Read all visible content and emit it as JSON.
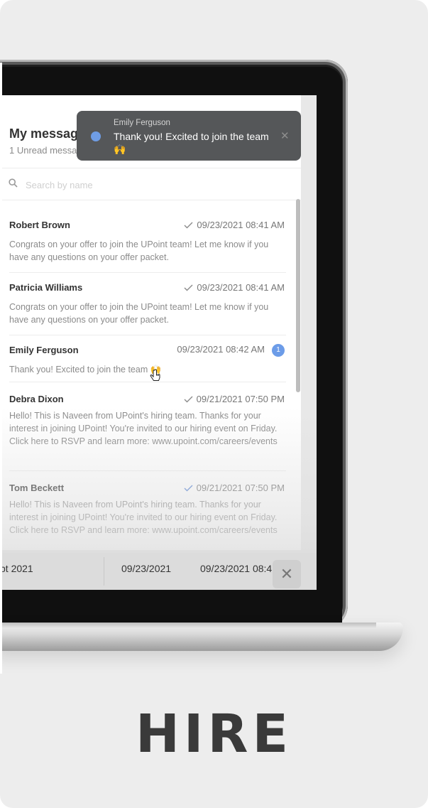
{
  "panel": {
    "title": "My messages",
    "subtitle": "1 Unread messages"
  },
  "search": {
    "placeholder": "Search by name",
    "icon": "search-icon"
  },
  "threads": [
    {
      "name": "Robert Brown",
      "time": "09/23/2021 08:41 AM",
      "status": "read-check",
      "preview": "Congrats on your offer to join the UPoint team! Let me know if you have any questions on your offer packet."
    },
    {
      "name": "Patricia Williams",
      "time": "09/23/2021 08:41 AM",
      "status": "read-check",
      "preview": "Congrats on your offer to join the UPoint team! Let me know if you have any questions on your offer packet."
    },
    {
      "name": "Emily Ferguson",
      "time": "09/23/2021 08:42 AM",
      "unread_count": "1",
      "preview": "Thank you! Excited to join the team 🙌"
    },
    {
      "name": "Debra Dixon",
      "time": "09/21/2021 07:50 PM",
      "status": "read-check",
      "preview": "Hello! This is Naveen from UPoint's hiring team. Thanks for your interest in joining UPoint! You're invited to our hiring event on Friday. Click here to RSVP and learn more: www.upoint.com/careers/events"
    },
    {
      "name": "Tom Beckett",
      "time": "09/21/2021 07:50 PM",
      "status": "read-check-blue",
      "preview": "Hello! This is Naveen from UPoint's hiring team. Thanks for your interest in joining UPoint! You're invited to our hiring event on Friday. Click here to RSVP and learn more: www.upoint.com/careers/events"
    }
  ],
  "background_dates": {
    "cell1": "pt 2021",
    "cell2": "09/23/2021",
    "cell3": "09/23/2021 08:4"
  },
  "toast": {
    "sender": "Emily Ferguson",
    "message": "Thank you! Excited to join the team 🙌",
    "close_icon": "close-icon"
  },
  "footer": {
    "heading": "HIRE"
  },
  "colors": {
    "card_bg": "#ededed",
    "accent_blue": "#6c9ce8",
    "toast_bg": "#555759",
    "heading": "#3a3a3a"
  }
}
